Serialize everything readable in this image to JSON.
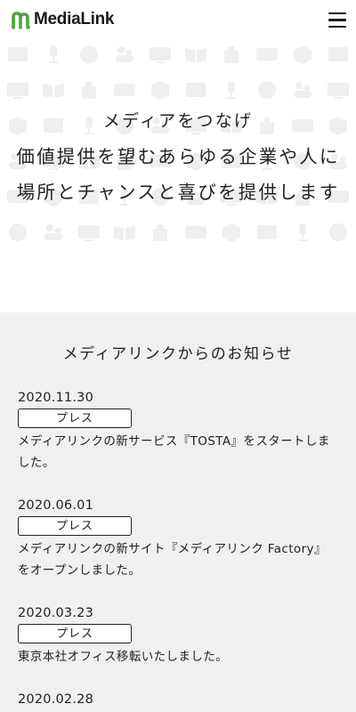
{
  "header": {
    "logo_text": "MediaLink",
    "logo_icon": "medialink-logo-icon",
    "menu_icon": "hamburger-menu-icon",
    "brand_color": "#4aa63a"
  },
  "hero": {
    "lines": [
      "メディアをつなげ",
      "価値提供を望むあらゆる企業や人に",
      "場所とチャンスと喜びを提供します"
    ]
  },
  "news": {
    "title": "メディアリンクからのお知らせ",
    "items": [
      {
        "date": "2020.11.30",
        "tag": "プレス",
        "text": "メディアリンクの新サービス『TOSTA』をスタートしました。"
      },
      {
        "date": "2020.06.01",
        "tag": "プレス",
        "text": "メディアリンクの新サイト『メディアリンク Factory』 をオープンしました。"
      },
      {
        "date": "2020.03.23",
        "tag": "プレス",
        "text": "東京本社オフィス移転いたしました。"
      },
      {
        "date": "2020.02.28",
        "tag": "",
        "text": ""
      }
    ]
  }
}
